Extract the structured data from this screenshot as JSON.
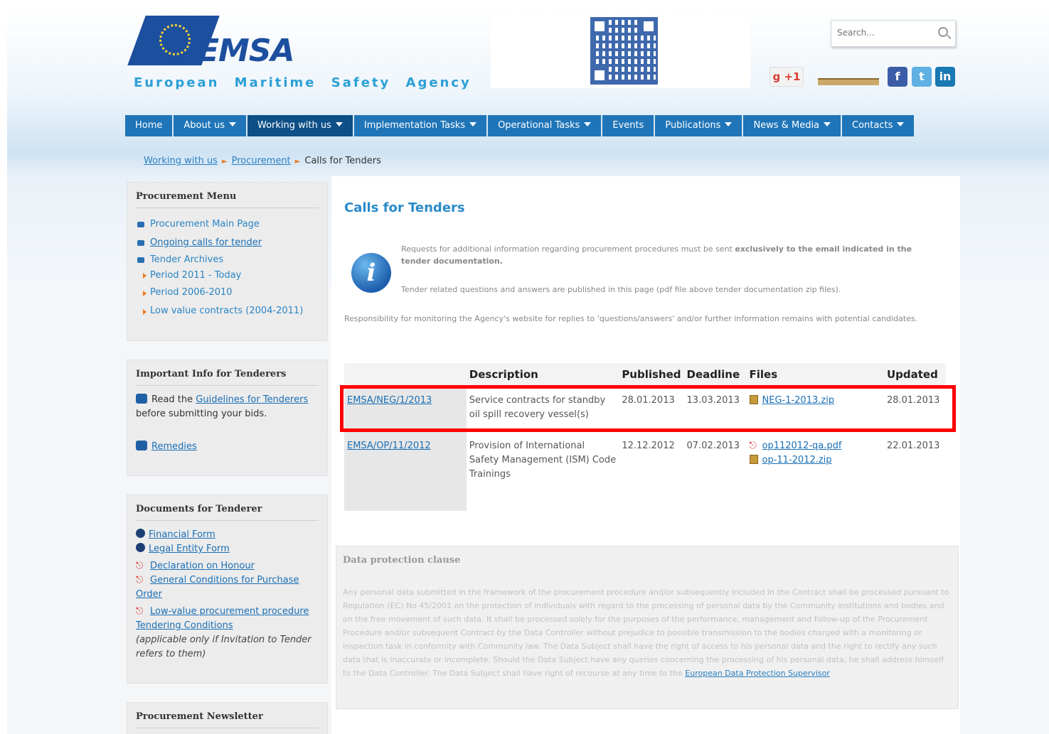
{
  "header": {
    "logo_text": "EMSA",
    "agency_name": "European Maritime Safety Agency",
    "search_placeholder": "Search...",
    "gplus_label": "g +1",
    "social": {
      "facebook": "f",
      "twitter": "t",
      "linkedin": "in"
    }
  },
  "nav": {
    "items": [
      {
        "label": "Home"
      },
      {
        "label": "About us"
      },
      {
        "label": "Working with us"
      },
      {
        "label": "Implementation Tasks"
      },
      {
        "label": "Operational Tasks"
      },
      {
        "label": "Events"
      },
      {
        "label": "Publications"
      },
      {
        "label": "News & Media"
      },
      {
        "label": "Contacts"
      }
    ]
  },
  "breadcrumb": {
    "items": [
      "Working with us",
      "Procurement"
    ],
    "current": "Calls for Tenders"
  },
  "sidebar": {
    "procurement_menu": {
      "title": "Procurement Menu",
      "items": [
        "Procurement Main Page",
        "Ongoing calls for tender",
        "Tender Archives"
      ],
      "sub_items": [
        "Period 2011 - Today",
        "Period 2006-2010",
        "Low value contracts (2004-2011)"
      ]
    },
    "important_info": {
      "title": "Important Info for Tenderers",
      "read_prefix": "Read the",
      "guidelines_link": "Guidelines for Tenderers",
      "read_suffix": "before submitting your bids.",
      "remedies_link": "Remedies"
    },
    "documents": {
      "title": "Documents for Tenderer",
      "items": [
        "Financial Form",
        "Legal Entity Form",
        "Declaration on Honour",
        "General Conditions for Purchase Order",
        "Low-value procurement procedure Tendering Conditions"
      ],
      "note": "(applicable only if Invitation to Tender refers to them)"
    },
    "newsletter": {
      "title": "Procurement Newsletter"
    }
  },
  "main": {
    "title": "Calls for Tenders",
    "note1_start": "Requests for additional information regarding procurement procedures must be sent",
    "note1_bold": "exclusively to the email indicated in the tender documentation.",
    "note2": "Tender related questions and answers are published in this page (pdf file above tender documentation zip files).",
    "note3": "Responsibility for monitoring the Agency's website for replies to 'questions/answers' and/or further information remains with potential candidates.",
    "table": {
      "headers": [
        "",
        "Description",
        "Published",
        "Deadline",
        "Files",
        "Updated"
      ],
      "rows": [
        {
          "ref": "EMSA/NEG/1/2013",
          "description": "Service contracts for standby oil spill recovery vessel(s)",
          "published": "28.01.2013",
          "deadline": "13.03.2013",
          "files": [
            "NEG-1-2013.zip"
          ],
          "updated": "28.01.2013"
        },
        {
          "ref": "EMSA/OP/11/2012",
          "description": "Provision of International Safety Management (ISM) Code Trainings",
          "published": "12.12.2012",
          "deadline": "07.02.2013",
          "files": [
            "op112012-qa.pdf",
            "op-11-2012.zip"
          ],
          "updated": "22.01.2013"
        }
      ]
    }
  },
  "data_protection": {
    "title": "Data protection clause",
    "text": "Any personal data submitted in the framework of the procurement procedure and/or subsequently included in the Contract shall be processed pursuant to Regulation (EC) No 45/2001 on the protection of individuals with regard to the processing of personal data by the Community institutions and bodies and on the free movement of such data. It shall be processed solely for the purposes of the performance, management and follow-up of the Procurement Procedure and/or subsequent Contract by the Data Controller without prejudice to possible transmission to the bodies charged with a monitoring or inspection task in conformity with Community law. The Data Subject shall have the right of access to his personal data and the right to rectify any such data that is inaccurate or incomplete. Should the Data Subject have any queries concerning the processing of his personal data, he shall address himself to the Data Controller. The Data Subject shall have right of recourse at any time to the",
    "link": "European Data Protection Supervisor"
  }
}
